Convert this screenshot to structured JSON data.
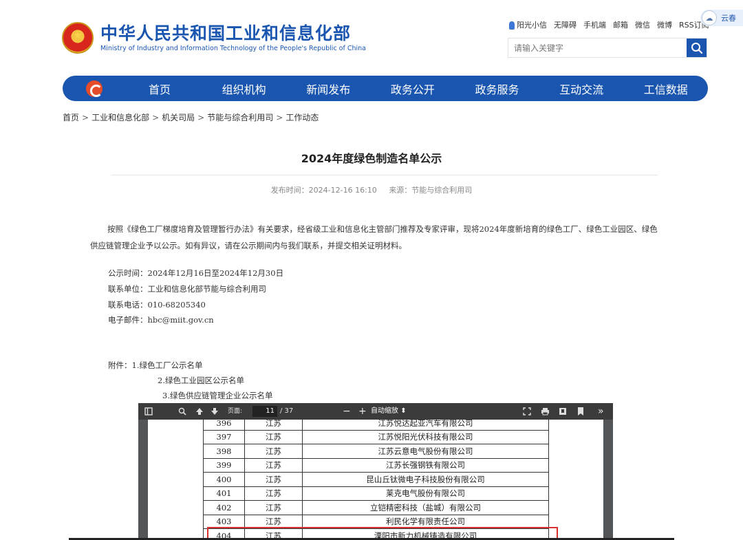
{
  "header": {
    "logo_cn": "中华人民共和国工业和信息化部",
    "logo_en": "Ministry of Industry and Information Technology of the People's Republic of China",
    "top_links": [
      "阳光小信",
      "无障碍",
      "手机端",
      "邮箱",
      "微信",
      "微博",
      "RSS订阅"
    ],
    "cloud_label": "云春",
    "search_placeholder": "请输入关键字"
  },
  "nav": {
    "items": [
      "首页",
      "组织机构",
      "新闻发布",
      "政务公开",
      "政务服务",
      "互动交流",
      "工信数据"
    ]
  },
  "breadcrumb": [
    "首页",
    "工业和信息化部",
    "机关司局",
    "节能与综合利用司",
    "工作动态"
  ],
  "article": {
    "title": "2024年度绿色制造名单公示",
    "publish_time": "发布时间：2024-12-16 16:10",
    "source": "来源：节能与综合利用司",
    "paragraph": "按照《绿色工厂梯度培育及管理暂行办法》有关要求，经省级工业和信息化主管部门推荐及专家评审，现将2024年度新培育的绿色工厂、绿色工业园区、绿色供应链管理企业予以公示。如有异议，请在公示期间内与我们联系，并提交相关证明材料。",
    "notice_period": "公示时间：2024年12月16日至2024年12月30日",
    "contact_unit": "联系单位：工业和信息化部节能与综合利用司",
    "contact_phone": "联系电话：010-68205340",
    "email": "电子邮件：hbc@miit.gov.cn",
    "attachments": [
      "附件：1.绿色工厂公示名单",
      "2.绿色工业园区公示名单",
      "3.绿色供应链管理企业公示名单"
    ]
  },
  "pdf_viewer": {
    "page_label": "页面:",
    "current_page": "11",
    "total_pages": "/ 37",
    "zoom": "自动缩放",
    "rows": [
      {
        "no": "396",
        "province": "江苏",
        "company": "江苏悦达起亚汽车有限公司"
      },
      {
        "no": "397",
        "province": "江苏",
        "company": "江苏悦阳光伏科技有限公司"
      },
      {
        "no": "398",
        "province": "江苏",
        "company": "江苏云意电气股份有限公司"
      },
      {
        "no": "399",
        "province": "江苏",
        "company": "江苏长强钢铁有限公司"
      },
      {
        "no": "400",
        "province": "江苏",
        "company": "昆山丘钛微电子科技股份有限公司"
      },
      {
        "no": "401",
        "province": "江苏",
        "company": "莱克电气股份有限公司"
      },
      {
        "no": "402",
        "province": "江苏",
        "company": "立铠精密科技（盐城）有限公司"
      },
      {
        "no": "403",
        "province": "江苏",
        "company": "利民化学有限责任公司"
      },
      {
        "no": "404",
        "province": "江苏",
        "company": "溧阳市新力机械铸造有限公司"
      }
    ],
    "highlight_color": "#d9322e"
  },
  "colors": {
    "brand_blue": "#1a56b0"
  }
}
